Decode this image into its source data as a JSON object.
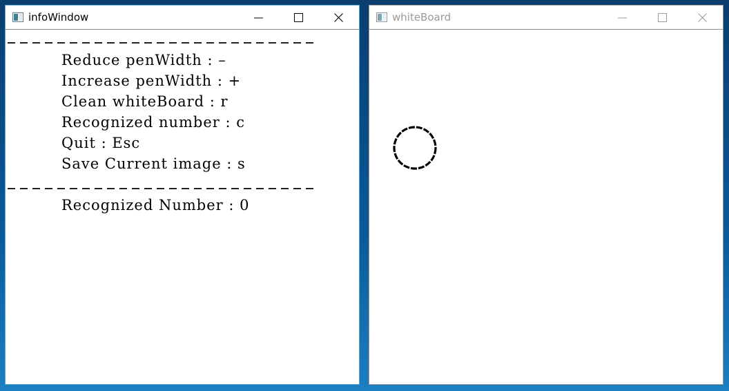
{
  "info_window": {
    "title": "infoWindow",
    "lines": [
      "Reduce penWidth : –",
      "Increase penWidth : +",
      "Clean whiteBoard : r",
      "Recognized number : c",
      "Quit : Esc",
      "Save Current image : s"
    ],
    "result_line": "Recognized Number : 0"
  },
  "board_window": {
    "title": "whiteBoard"
  },
  "icons": {
    "app": "app-window-icon",
    "minimize": "minimize-icon",
    "maximize": "maximize-icon",
    "close": "close-icon"
  }
}
